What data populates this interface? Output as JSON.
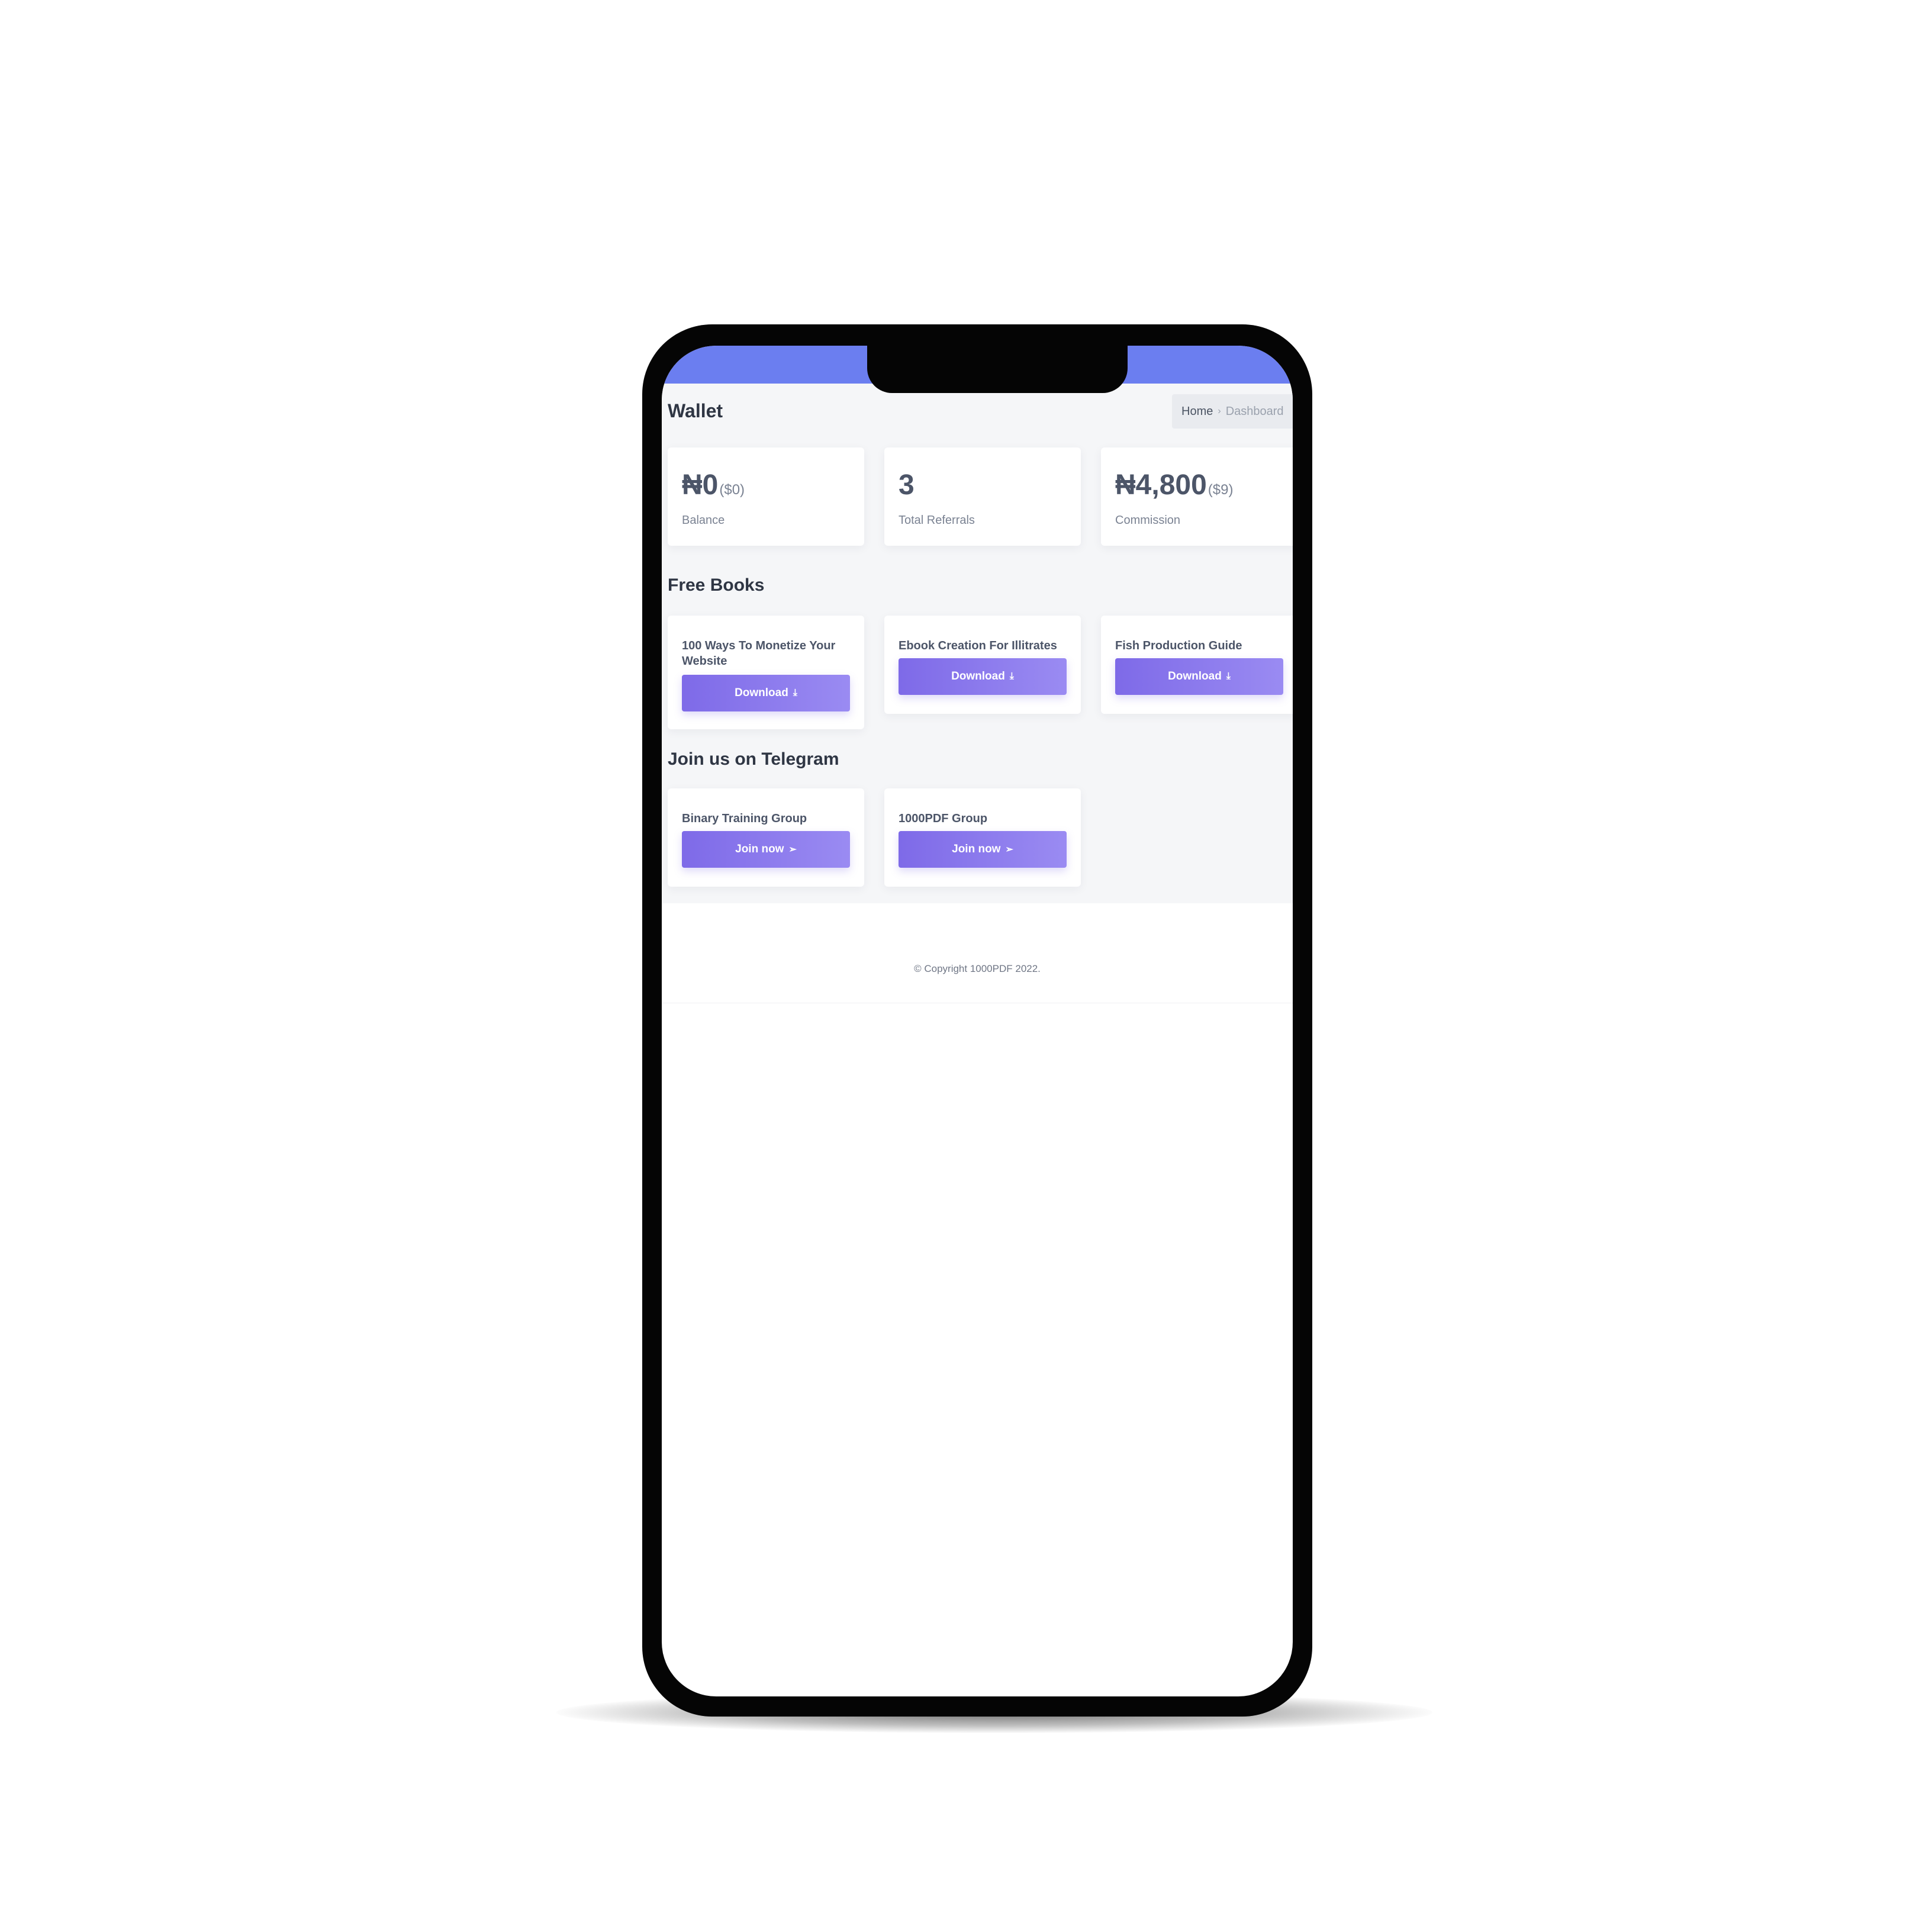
{
  "header": {
    "page_title": "Wallet",
    "breadcrumb": {
      "home": "Home",
      "separator": "›",
      "current": "Dashboard"
    }
  },
  "stats": [
    {
      "value": "₦0",
      "sub": "($0)",
      "label": "Balance"
    },
    {
      "value": "3",
      "sub": "",
      "label": "Total Referrals"
    },
    {
      "value": "₦4,800",
      "sub": "($9)",
      "label": "Commission"
    }
  ],
  "free_books": {
    "title": "Free Books",
    "items": [
      {
        "title": "100 Ways To Monetize Your Website",
        "button_label": "Download",
        "button_icon": "download-icon"
      },
      {
        "title": "Ebook Creation For Illitrates",
        "button_label": "Download",
        "button_icon": "download-icon"
      },
      {
        "title": "Fish Production Guide",
        "button_label": "Download",
        "button_icon": "download-icon"
      }
    ]
  },
  "telegram": {
    "title": "Join us on Telegram",
    "items": [
      {
        "title": "Binary Training Group",
        "button_label": "Join now",
        "button_icon": "send-icon"
      },
      {
        "title": "1000PDF Group",
        "button_label": "Join now",
        "button_icon": "send-icon"
      }
    ]
  },
  "footer": {
    "copyright": "© Copyright 1000PDF 2022."
  },
  "colors": {
    "topbar": "#6b7ef0",
    "button_start": "#7e6ae8",
    "button_end": "#9a8bf2",
    "heading": "#2f3644",
    "page_background": "#f5f6f8"
  }
}
